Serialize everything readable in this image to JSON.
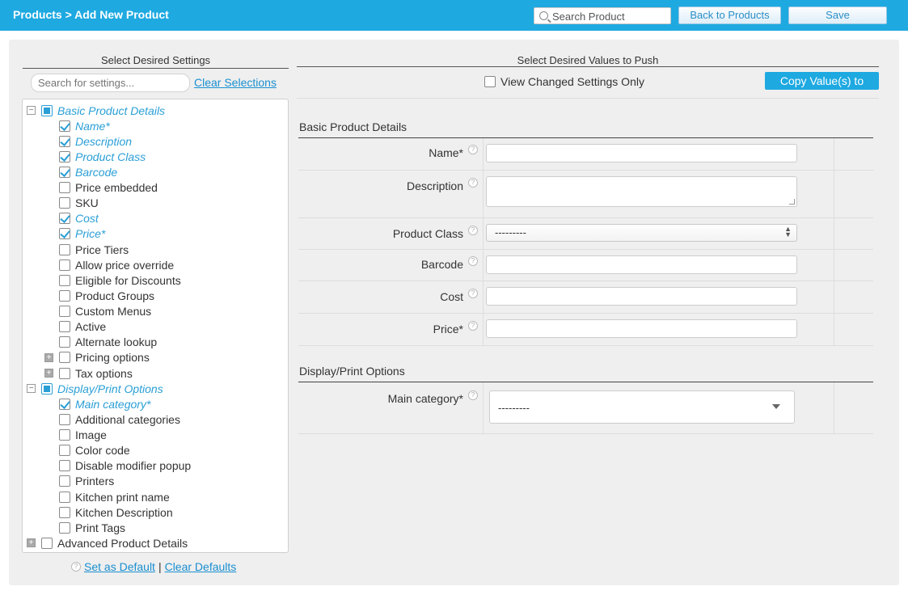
{
  "header": {
    "breadcrumb": "Products > Add New Product",
    "search_placeholder": "Search Product",
    "back_label": "Back to Products",
    "save_label": "Save"
  },
  "left": {
    "title": "Select Desired Settings",
    "search_placeholder": "Search for settings...",
    "clear_selections": "Clear Selections",
    "tree": [
      {
        "label": "Basic Product Details",
        "level": 0,
        "expander": "minus",
        "state": "partial",
        "selected": true
      },
      {
        "label": "Name*",
        "level": 1,
        "state": "checked",
        "selected": true
      },
      {
        "label": "Description",
        "level": 1,
        "state": "checked",
        "selected": true
      },
      {
        "label": "Product Class",
        "level": 1,
        "state": "checked",
        "selected": true
      },
      {
        "label": "Barcode",
        "level": 1,
        "state": "checked",
        "selected": true
      },
      {
        "label": "Price embedded",
        "level": 1,
        "state": "unchecked",
        "selected": false
      },
      {
        "label": "SKU",
        "level": 1,
        "state": "unchecked",
        "selected": false
      },
      {
        "label": "Cost",
        "level": 1,
        "state": "checked",
        "selected": true
      },
      {
        "label": "Price*",
        "level": 1,
        "state": "checked",
        "selected": true
      },
      {
        "label": "Price Tiers",
        "level": 1,
        "state": "unchecked",
        "selected": false
      },
      {
        "label": "Allow price override",
        "level": 1,
        "state": "unchecked",
        "selected": false
      },
      {
        "label": "Eligible for Discounts",
        "level": 1,
        "state": "unchecked",
        "selected": false
      },
      {
        "label": "Product Groups",
        "level": 1,
        "state": "unchecked",
        "selected": false
      },
      {
        "label": "Custom Menus",
        "level": 1,
        "state": "unchecked",
        "selected": false
      },
      {
        "label": "Active",
        "level": 1,
        "state": "unchecked",
        "selected": false
      },
      {
        "label": "Alternate lookup",
        "level": 1,
        "state": "unchecked",
        "selected": false
      },
      {
        "label": "Pricing options",
        "level": 1,
        "expander": "plus",
        "state": "unchecked",
        "selected": false
      },
      {
        "label": "Tax options",
        "level": 1,
        "expander": "plus",
        "state": "unchecked",
        "selected": false
      },
      {
        "label": "Display/Print Options",
        "level": 0,
        "expander": "minus",
        "state": "partial",
        "selected": true
      },
      {
        "label": "Main category*",
        "level": 1,
        "state": "checked",
        "selected": true
      },
      {
        "label": "Additional categories",
        "level": 1,
        "state": "unchecked",
        "selected": false
      },
      {
        "label": "Image",
        "level": 1,
        "state": "unchecked",
        "selected": false
      },
      {
        "label": "Color code",
        "level": 1,
        "state": "unchecked",
        "selected": false
      },
      {
        "label": "Disable modifier popup",
        "level": 1,
        "state": "unchecked",
        "selected": false
      },
      {
        "label": "Printers",
        "level": 1,
        "state": "unchecked",
        "selected": false
      },
      {
        "label": "Kitchen print name",
        "level": 1,
        "state": "unchecked",
        "selected": false
      },
      {
        "label": "Kitchen Description",
        "level": 1,
        "state": "unchecked",
        "selected": false
      },
      {
        "label": "Print Tags",
        "level": 1,
        "state": "unchecked",
        "selected": false
      },
      {
        "label": "Advanced Product Details",
        "level": 0,
        "expander": "plus",
        "state": "unchecked",
        "selected": false
      }
    ],
    "set_default": "Set as Default",
    "separator": "|",
    "clear_defaults": "Clear Defaults"
  },
  "right": {
    "title": "Select Desired Values to Push",
    "view_changed": "View Changed Settings Only",
    "copy_label": "Copy Value(s) to",
    "section1": "Basic Product Details",
    "fields": {
      "name": "Name*",
      "description": "Description",
      "product_class": "Product Class",
      "product_class_value": "---------",
      "barcode": "Barcode",
      "cost": "Cost",
      "price": "Price*"
    },
    "section2": "Display/Print Options",
    "main_category": "Main category*",
    "main_category_value": "---------"
  },
  "colors": {
    "accent": "#1ea9e1",
    "selected_text": "#2a9fd6",
    "panel_bg": "#efefef"
  }
}
